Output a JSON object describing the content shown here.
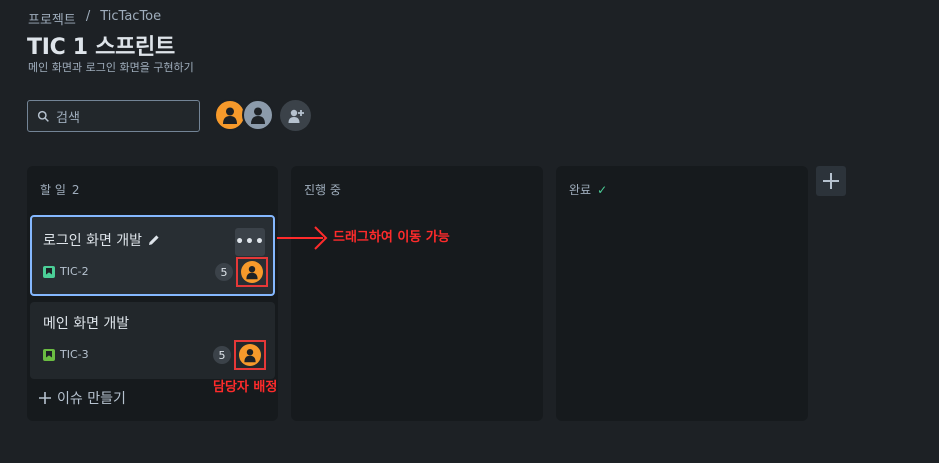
{
  "breadcrumb": {
    "project": "프로젝트",
    "separator": "/",
    "board": "TicTacToe"
  },
  "page": {
    "title": "TIC 1 스프린트",
    "subtitle": "메인 화면과 로그인 화면을 구현하기"
  },
  "search": {
    "placeholder": "검색",
    "icon": "search-icon"
  },
  "avatars": [
    "user-avatar-orange",
    "user-avatar-gray"
  ],
  "columns": [
    {
      "name": "할 일",
      "count": "2"
    },
    {
      "name": "진행 중"
    },
    {
      "name": "완료",
      "icon": "check-icon"
    }
  ],
  "cards": [
    {
      "title": "로그인 화면 개발",
      "key": "TIC-2",
      "points": "5"
    },
    {
      "title": "메인 화면 개발",
      "key": "TIC-3",
      "points": "5"
    }
  ],
  "create_issue": "이슈 만들기",
  "annotations": {
    "drag": "드래그하여 이동 가능",
    "assign": "담당자 배정"
  },
  "colors": {
    "background": "#1d2125",
    "column": "#161a1d",
    "card": "#22272b",
    "accent": "#85b8ff",
    "annotation": "#ff2b2b",
    "avatar": "#f79a2b"
  }
}
